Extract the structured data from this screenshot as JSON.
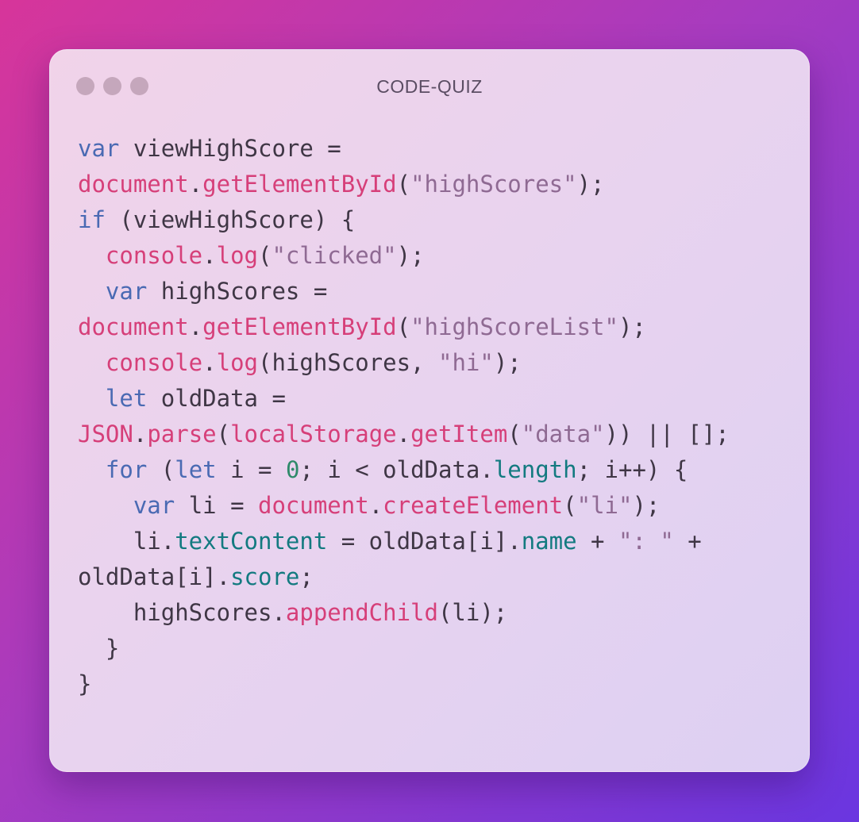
{
  "window": {
    "title": "CODE-QUIZ"
  },
  "colors": {
    "keyword": "#4a6ab3",
    "function": "#d63f79",
    "string": "#8f6a93",
    "property": "#137a80",
    "number": "#2f8a6a",
    "plain": "#3f3645"
  },
  "code_lines": [
    [
      {
        "t": "kw",
        "v": "var"
      },
      {
        "t": "plain",
        "v": " viewHighScore ="
      }
    ],
    [
      {
        "t": "fn",
        "v": "document"
      },
      {
        "t": "plain",
        "v": "."
      },
      {
        "t": "fn",
        "v": "getElementById"
      },
      {
        "t": "plain",
        "v": "("
      },
      {
        "t": "str",
        "v": "\"highScores\""
      },
      {
        "t": "plain",
        "v": ");"
      }
    ],
    [
      {
        "t": "kw",
        "v": "if"
      },
      {
        "t": "plain",
        "v": " (viewHighScore) {"
      }
    ],
    [
      {
        "t": "plain",
        "v": "  "
      },
      {
        "t": "fn",
        "v": "console"
      },
      {
        "t": "plain",
        "v": "."
      },
      {
        "t": "fn",
        "v": "log"
      },
      {
        "t": "plain",
        "v": "("
      },
      {
        "t": "str",
        "v": "\"clicked\""
      },
      {
        "t": "plain",
        "v": ");"
      }
    ],
    [
      {
        "t": "plain",
        "v": "  "
      },
      {
        "t": "kw",
        "v": "var"
      },
      {
        "t": "plain",
        "v": " highScores ="
      }
    ],
    [
      {
        "t": "fn",
        "v": "document"
      },
      {
        "t": "plain",
        "v": "."
      },
      {
        "t": "fn",
        "v": "getElementById"
      },
      {
        "t": "plain",
        "v": "("
      },
      {
        "t": "str",
        "v": "\"highScoreList\""
      },
      {
        "t": "plain",
        "v": ");"
      }
    ],
    [
      {
        "t": "plain",
        "v": "  "
      },
      {
        "t": "fn",
        "v": "console"
      },
      {
        "t": "plain",
        "v": "."
      },
      {
        "t": "fn",
        "v": "log"
      },
      {
        "t": "plain",
        "v": "(highScores, "
      },
      {
        "t": "str",
        "v": "\"hi\""
      },
      {
        "t": "plain",
        "v": ");"
      }
    ],
    [
      {
        "t": "plain",
        "v": "  "
      },
      {
        "t": "kw",
        "v": "let"
      },
      {
        "t": "plain",
        "v": " oldData ="
      }
    ],
    [
      {
        "t": "fn",
        "v": "JSON"
      },
      {
        "t": "plain",
        "v": "."
      },
      {
        "t": "fn",
        "v": "parse"
      },
      {
        "t": "plain",
        "v": "("
      },
      {
        "t": "fn",
        "v": "localStorage"
      },
      {
        "t": "plain",
        "v": "."
      },
      {
        "t": "fn",
        "v": "getItem"
      },
      {
        "t": "plain",
        "v": "("
      },
      {
        "t": "str",
        "v": "\"data\""
      },
      {
        "t": "plain",
        "v": ")) || [];"
      }
    ],
    [
      {
        "t": "plain",
        "v": "  "
      },
      {
        "t": "kw",
        "v": "for"
      },
      {
        "t": "plain",
        "v": " ("
      },
      {
        "t": "kw",
        "v": "let"
      },
      {
        "t": "plain",
        "v": " i = "
      },
      {
        "t": "num",
        "v": "0"
      },
      {
        "t": "plain",
        "v": "; i < oldData."
      },
      {
        "t": "prop",
        "v": "length"
      },
      {
        "t": "plain",
        "v": "; i++) {"
      }
    ],
    [
      {
        "t": "plain",
        "v": "    "
      },
      {
        "t": "kw",
        "v": "var"
      },
      {
        "t": "plain",
        "v": " li = "
      },
      {
        "t": "fn",
        "v": "document"
      },
      {
        "t": "plain",
        "v": "."
      },
      {
        "t": "fn",
        "v": "createElement"
      },
      {
        "t": "plain",
        "v": "("
      },
      {
        "t": "str",
        "v": "\"li\""
      },
      {
        "t": "plain",
        "v": ");"
      }
    ],
    [
      {
        "t": "plain",
        "v": "    li."
      },
      {
        "t": "prop",
        "v": "textContent"
      },
      {
        "t": "plain",
        "v": " = oldData[i]."
      },
      {
        "t": "prop",
        "v": "name"
      },
      {
        "t": "plain",
        "v": " + "
      },
      {
        "t": "str",
        "v": "\": \""
      },
      {
        "t": "plain",
        "v": " +"
      }
    ],
    [
      {
        "t": "plain",
        "v": "oldData[i]."
      },
      {
        "t": "prop",
        "v": "score"
      },
      {
        "t": "plain",
        "v": ";"
      }
    ],
    [
      {
        "t": "plain",
        "v": "    highScores."
      },
      {
        "t": "fn",
        "v": "appendChild"
      },
      {
        "t": "plain",
        "v": "(li);"
      }
    ],
    [
      {
        "t": "plain",
        "v": "  }"
      }
    ],
    [
      {
        "t": "plain",
        "v": "}"
      }
    ]
  ]
}
